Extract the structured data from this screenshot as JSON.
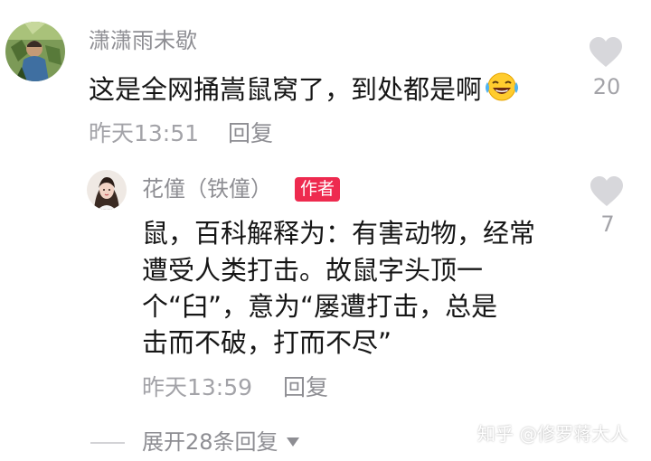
{
  "comment": {
    "user_name": "潇潇雨未歇",
    "text": "这是全网捅嵩鼠窝了，到处都是啊",
    "emoji": "laughing-tears-emoji",
    "time": "昨天13:51",
    "reply_label": "回复",
    "like_count": "20"
  },
  "reply": {
    "user_name": "花僮（铁僮）",
    "author_badge": "作者",
    "lines": [
      "鼠，百科解释为：有害动物，经常",
      "遭受人类打击。故鼠字头顶一",
      "个“臼”，意为“屡遭打击，总是",
      "击而不破，打而不尽”"
    ],
    "time": "昨天13:59",
    "reply_label": "回复",
    "like_count": "7"
  },
  "expand": {
    "label": "展开28条回复"
  },
  "watermark": {
    "text": "知乎 @修罗蒋大人"
  },
  "colors": {
    "badge": "#ee2a4f",
    "heart": "#d7d7db",
    "secondary_text": "#8e8e93"
  }
}
